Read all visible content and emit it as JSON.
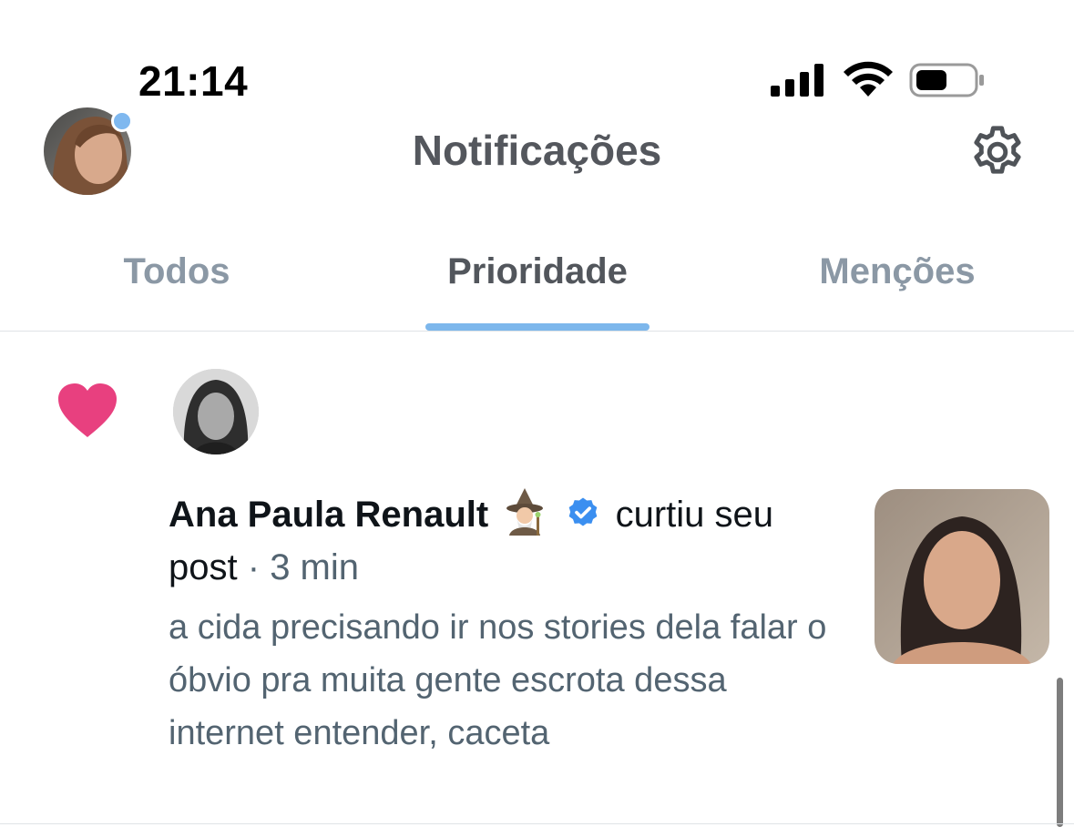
{
  "status_bar": {
    "time": "21:14"
  },
  "header": {
    "title": "Notificações"
  },
  "tabs": [
    {
      "label": "Todos",
      "active": false
    },
    {
      "label": "Prioridade",
      "active": true
    },
    {
      "label": "Menções",
      "active": false
    }
  ],
  "notification": {
    "type_icon": "heart-icon",
    "actor_name": "Ana Paula Renault",
    "actor_emoji": "🧙🏻‍♀️",
    "action": "curtiu seu post",
    "separator": "·",
    "time_ago": "3 min",
    "post_text": "a cida precisando ir nos stories dela falar o óbvio pra muita gente escrota dessa internet entender, caceta"
  },
  "colors": {
    "accent": "#7db7ec",
    "like": "#e8407f",
    "verified": "#3b8ff0",
    "muted_text": "#536471",
    "inactive_tab": "#8b98a5"
  }
}
